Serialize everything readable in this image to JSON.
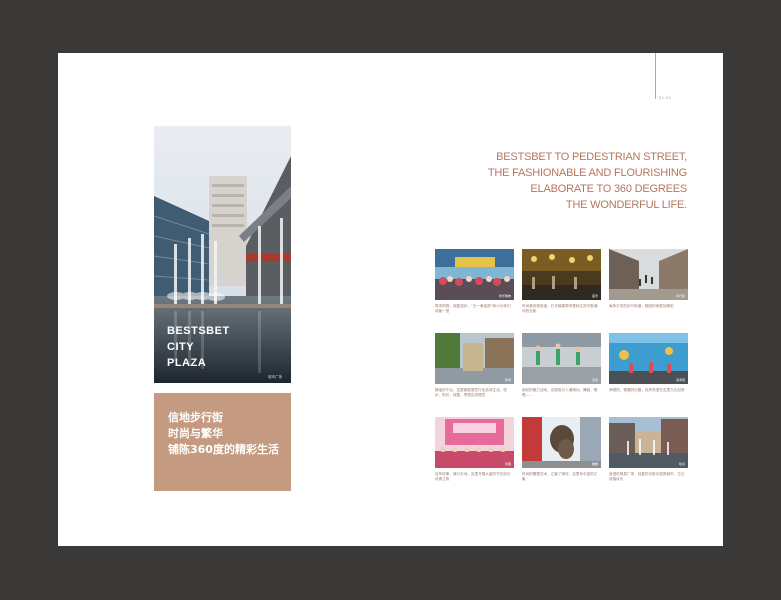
{
  "page": {
    "number": "01.01"
  },
  "hero": {
    "caption_lines": [
      "BESTSBET",
      "CITY",
      "PLAZA"
    ],
    "photo_credit": "城市广场"
  },
  "slogan": {
    "lines": [
      "信地步行街",
      "时尚与繁华",
      "铺陈360度的精彩生活"
    ]
  },
  "heading": {
    "lines": [
      "BESTSBET TO PEDESTRIAN STREET,",
      "THE FASHIONABLE AND FLOURISHING",
      "ELABORATE TO 360 DEGREES",
      "THE WONDERFUL LIFE."
    ]
  },
  "colors": {
    "background": "#3a3937",
    "page": "#ffffff",
    "accent": "#b5765c",
    "tan_block": "#c49a80"
  },
  "thumbnails": [
    {
      "label": "欢乐购物",
      "caption": "周末购物，轻盈漫步。“五一黄金周”和小伙伴们欢聚一堂"
    },
    {
      "label": "夜景",
      "caption": "时尚潮流夜街道，灯光璀璨带来蓬勃生机不断涌动的光影"
    },
    {
      "label": "步行街",
      "caption": "每条平坦的步行街道，都因你而更加精彩"
    },
    {
      "label": "休闲",
      "caption": "静谧的午后，这里都能惬意行走品味生活，信步，阳光，绿茵，享受自然惬意"
    },
    {
      "label": "活动",
      "caption": "缤纷的魅力活动，总能吸引人潮涌动，舞蹈，歌唱……"
    },
    {
      "label": "海洋馆",
      "caption": "养眼的，健康的乐趣，欢声笑语在这里久久回荡"
    },
    {
      "label": "庆典",
      "caption": "百年好事，缘分天地，这里开展大量的节日欢乐庆典之夜"
    },
    {
      "label": "雕塑",
      "caption": "时尚的雕塑艺术，汇聚了美好，这里有丰富的汇聚"
    },
    {
      "label": "喷泉",
      "caption": "浪漫的喷泉广场，轻盈的光影中感受城市，忘记烦恼欢乐"
    }
  ]
}
